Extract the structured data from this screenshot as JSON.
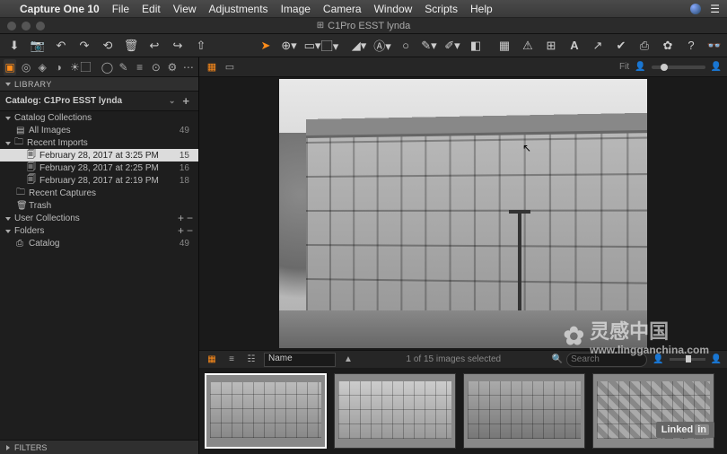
{
  "menu": {
    "apple": "",
    "app": "Capture One 10",
    "items": [
      "File",
      "Edit",
      "View",
      "Adjustments",
      "Image",
      "Camera",
      "Window",
      "Scripts",
      "Help"
    ]
  },
  "window_title": "C1Pro ESST lynda",
  "tooltabs_icons": [
    "folder",
    "camera",
    "gear",
    "sliders",
    "crop",
    "rotate",
    "search",
    "brush",
    "list",
    "layers",
    "settings",
    "more"
  ],
  "library": {
    "header": "LIBRARY",
    "catalog_label": "Catalog: C1Pro ESST lynda",
    "groups": {
      "catalog_collections": "Catalog Collections",
      "all_images": {
        "label": "All Images",
        "count": 49
      },
      "recent_imports": "Recent Imports",
      "imports": [
        {
          "label": "February 28, 2017 at 3:25 PM",
          "count": 15,
          "selected": true
        },
        {
          "label": "February 28, 2017 at 2:25 PM",
          "count": 16
        },
        {
          "label": "February 28, 2017 at 2:19 PM",
          "count": 18
        }
      ],
      "recent_captures": "Recent Captures",
      "trash": "Trash",
      "user_collections": "User Collections",
      "folders": "Folders",
      "catalog_item": {
        "label": "Catalog",
        "count": 49
      }
    },
    "filters": "FILTERS"
  },
  "viewer_bar": {
    "fit_label": "Fit"
  },
  "browser": {
    "sort_label": "Name",
    "status": "1 of 15 images selected",
    "search_placeholder": "Search"
  },
  "watermark": {
    "text": "灵感中国",
    "sub": "www.lingganchina.com"
  },
  "linkedin": "Linked"
}
